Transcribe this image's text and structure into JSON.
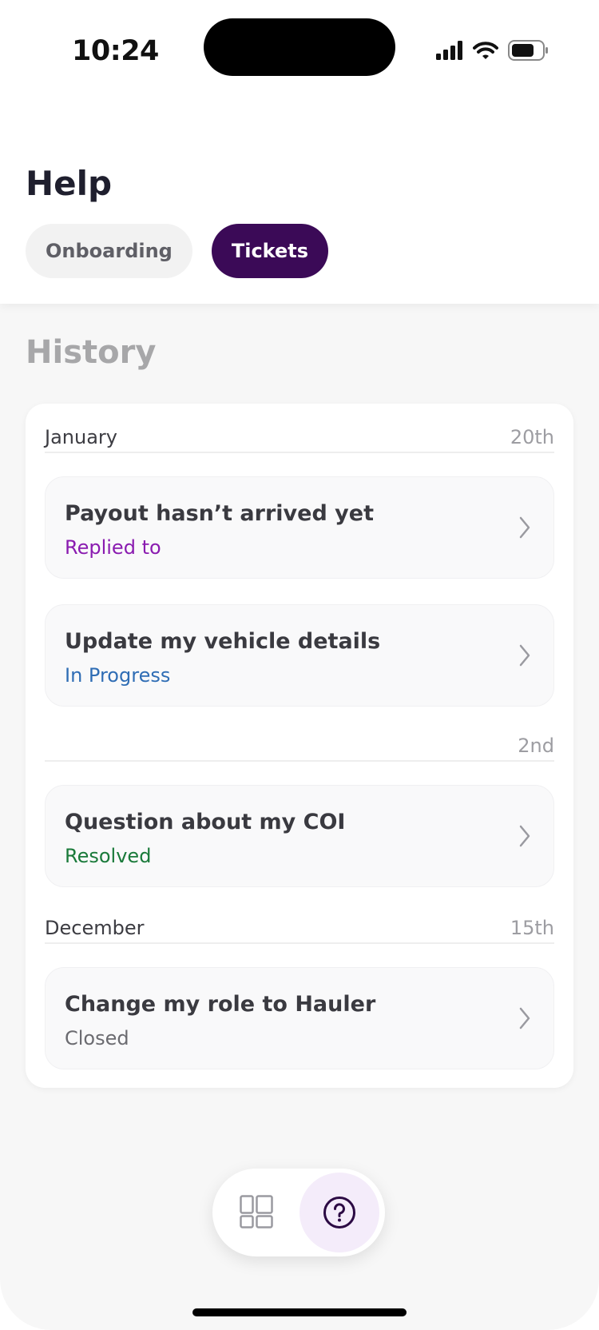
{
  "status_bar": {
    "time": "10:24"
  },
  "header": {
    "title": "Help",
    "tabs": [
      {
        "label": "Onboarding",
        "active": false
      },
      {
        "label": "Tickets",
        "active": true
      }
    ]
  },
  "history": {
    "title": "History",
    "groups": [
      {
        "month": "January",
        "day": "20th"
      },
      {
        "month": "",
        "day": "2nd"
      },
      {
        "month": "December",
        "day": "15th"
      }
    ],
    "tickets": [
      {
        "title": "Payout hasn’t arrived yet",
        "status": "Replied to",
        "status_color": "#8a1bb0"
      },
      {
        "title": "Update my vehicle details",
        "status": "In Progress",
        "status_color": "#2f6db5"
      },
      {
        "title": "Question about my COI",
        "status": "Resolved",
        "status_color": "#1a7a3a"
      },
      {
        "title": "Change my role to Hauler",
        "status": "Closed",
        "status_color": "#6b6b70"
      }
    ]
  },
  "bottom_nav": {
    "items": [
      {
        "icon": "dashboard-grid-icon",
        "active": false
      },
      {
        "icon": "help-question-icon",
        "active": true
      }
    ]
  },
  "colors": {
    "accent": "#3b0a57",
    "accent_soft": "#f4ecfa",
    "background": "#f7f7f7"
  }
}
